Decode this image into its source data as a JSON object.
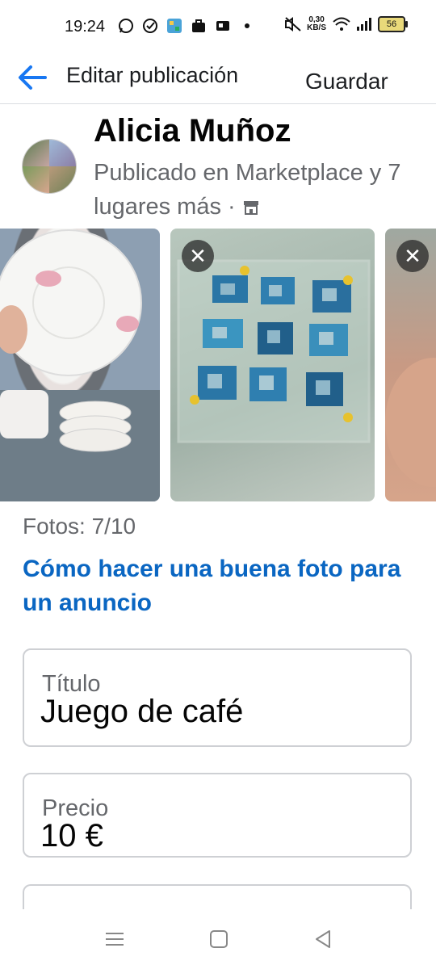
{
  "status": {
    "time": "19:24",
    "net_speed_value": "0,30",
    "net_speed_unit": "KB/S",
    "battery": "56",
    "icons": [
      "whatsapp-icon",
      "check-circle-icon",
      "app-tile-icon",
      "briefcase-icon",
      "vpn-icon",
      "dot-icon",
      "mute-icon",
      "wifi-icon",
      "signal-icon",
      "battery-icon"
    ]
  },
  "appbar": {
    "title": "Editar publicación",
    "save_label": "Guardar",
    "back_icon": "back-arrow-icon"
  },
  "post": {
    "user_name": "Alicia Muñoz",
    "subtitle": "Publicado en Marketplace y 7 lugares más ·",
    "shop_icon": "marketplace-shop-icon"
  },
  "gallery": {
    "close_glyph": "✕",
    "photos": [
      "photo-1",
      "photo-2",
      "photo-3"
    ]
  },
  "photos_count": "Fotos: 7/10",
  "tips_link": "Cómo hacer una buena foto para un anuncio",
  "form": {
    "title_label": "Título",
    "title_value": "Juego de café",
    "price_label": "Precio",
    "price_value": "10 €"
  },
  "colors": {
    "accent": "#1877f2",
    "link": "#0a66c2",
    "muted": "#65676b",
    "border": "#ced0d4"
  }
}
